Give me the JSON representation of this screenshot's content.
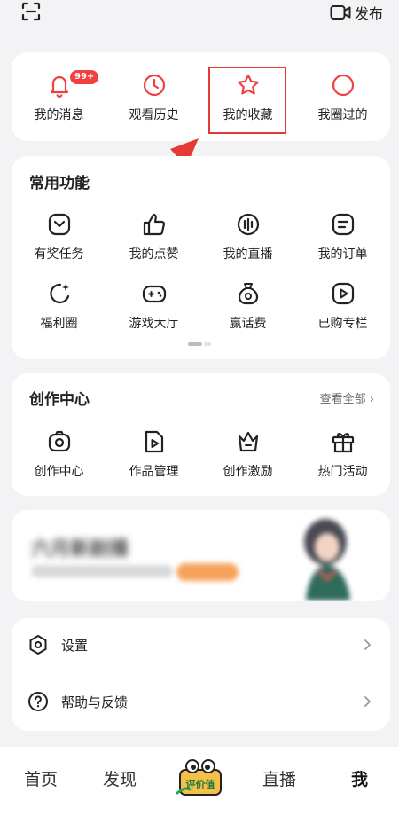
{
  "topbar": {
    "publish_label": "发布"
  },
  "quick": {
    "items": [
      {
        "label": "我的消息",
        "icon": "bell-icon",
        "badge": "99+"
      },
      {
        "label": "观看历史",
        "icon": "clock-icon"
      },
      {
        "label": "我的收藏",
        "icon": "star-icon"
      },
      {
        "label": "我圈过的",
        "icon": "circle-icon"
      }
    ]
  },
  "common": {
    "title": "常用功能",
    "items": [
      {
        "label": "有奖任务",
        "icon": "task-icon"
      },
      {
        "label": "我的点赞",
        "icon": "thumbs-up-icon"
      },
      {
        "label": "我的直播",
        "icon": "live-icon"
      },
      {
        "label": "我的订单",
        "icon": "order-icon"
      },
      {
        "label": "福利圈",
        "icon": "sparkle-moon-icon"
      },
      {
        "label": "游戏大厅",
        "icon": "gamepad-icon"
      },
      {
        "label": "赢话费",
        "icon": "money-bag-icon"
      },
      {
        "label": "已购专栏",
        "icon": "purchased-play-icon"
      }
    ]
  },
  "create": {
    "title": "创作中心",
    "see_all": "查看全部 ›",
    "items": [
      {
        "label": "创作中心",
        "icon": "camera-icon"
      },
      {
        "label": "作品管理",
        "icon": "video-file-icon"
      },
      {
        "label": "创作激励",
        "icon": "crown-icon"
      },
      {
        "label": "热门活动",
        "icon": "gift-icon"
      }
    ]
  },
  "banner": {
    "title": "六月新剧播"
  },
  "settings": {
    "items": [
      {
        "label": "设置",
        "icon": "settings-hex-icon"
      },
      {
        "label": "帮助与反馈",
        "icon": "help-icon"
      }
    ]
  },
  "nav": {
    "items": [
      {
        "label": "首页"
      },
      {
        "label": "发现"
      },
      {
        "label": "直播"
      },
      {
        "label": "我"
      }
    ],
    "center_logo_text": "评价值"
  },
  "colors": {
    "accent": "#f04040",
    "highlight": "#e53935",
    "background": "#f3f3f5"
  }
}
